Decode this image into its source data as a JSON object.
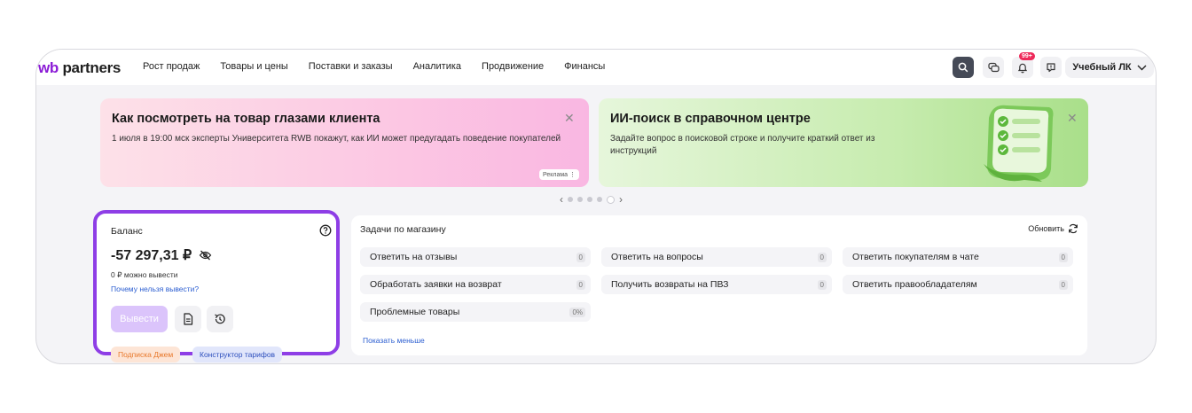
{
  "header": {
    "logo_wb": "wb",
    "logo_partners": "partners",
    "nav": [
      "Рост продаж",
      "Товары и цены",
      "Поставки и заказы",
      "Аналитика",
      "Продвижение",
      "Финансы"
    ],
    "notif_badge": "99+",
    "account": "Учебный ЛК"
  },
  "banners": [
    {
      "title": "Как посмотреть на товар глазами клиента",
      "text": "1 июля в 19:00 мск эксперты Университета RWB покажут, как ИИ может предугадать поведение покупателей",
      "ad_label": "Реклама ⋮"
    },
    {
      "title": "ИИ-поиск в справочном центре",
      "text": "Задайте вопрос в поисковой строке и получите краткий ответ из инструкций"
    }
  ],
  "balance": {
    "label": "Баланс",
    "amount": "-57 297,31 ₽",
    "available": "0 ₽ можно вывести",
    "why_link": "Почему нельзя вывести?",
    "withdraw_btn": "Вывести",
    "chips": [
      "Подписка Джем",
      "Конструктор тарифов"
    ]
  },
  "tasks": {
    "title": "Задачи по магазину",
    "refresh": "Обновить",
    "items": [
      {
        "label": "Ответить на отзывы",
        "count": "0"
      },
      {
        "label": "Ответить на вопросы",
        "count": "0"
      },
      {
        "label": "Ответить покупателям в чате",
        "count": "0"
      },
      {
        "label": "Обработать заявки на возврат",
        "count": "0"
      },
      {
        "label": "Получить возвраты на ПВЗ",
        "count": "0"
      },
      {
        "label": "Ответить правообладателям",
        "count": "0"
      },
      {
        "label": "Проблемные товары",
        "count": "0%"
      }
    ],
    "show_less": "Показать меньше"
  },
  "carousel": {
    "total": 5,
    "active": 5
  },
  "colors": {
    "accent": "#8e3ee6",
    "link": "#2d5fd1",
    "badge": "#ee2a5a"
  }
}
